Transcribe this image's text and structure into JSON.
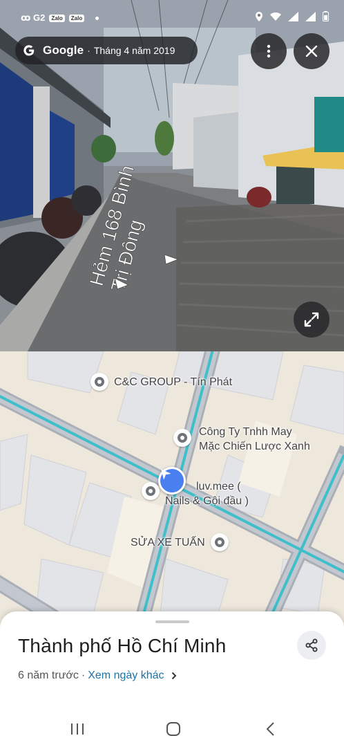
{
  "status_bar": {
    "left_text": "ꝏ G2",
    "apps": [
      "Zalo",
      "Zalo"
    ],
    "icons": [
      "location-icon",
      "wifi-icon",
      "signal-icon",
      "signal-icon",
      "battery-icon"
    ]
  },
  "header": {
    "brand": "Google",
    "separator": "·",
    "date": "Tháng 4 năm 2019"
  },
  "street_view": {
    "road_label_line1": "Hẻm 168 Bình",
    "road_label_line2": "Trị Đông"
  },
  "map": {
    "pois": [
      {
        "name": "C&C GROUP - Tín Phát"
      },
      {
        "name_line1": "Công Ty Tnhh May",
        "name_line2": "Mặc Chiến Lược Xanh"
      },
      {
        "name_line1": "luv.mee (",
        "name_line2": "Nails & Gội đầu )"
      },
      {
        "name": "SỬA XE TUẤN"
      }
    ]
  },
  "sheet": {
    "title": "Thành phố Hồ Chí Minh",
    "age": "6 năm trước",
    "dot": "·",
    "other_dates_link": "Xem ngày khác"
  },
  "colors": {
    "accent_blue": "#4a7ff0",
    "road_teal": "#3ebfc9",
    "link": "#1a73a8"
  }
}
